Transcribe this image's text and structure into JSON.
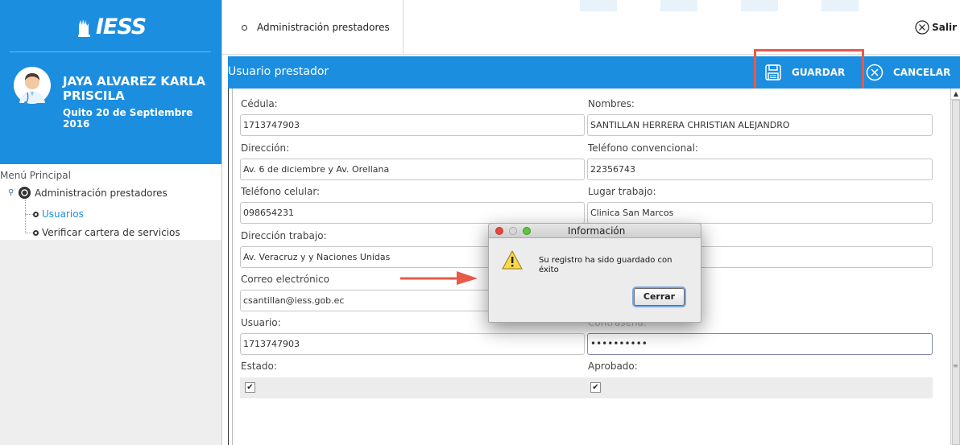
{
  "app": {
    "logo_text": "IESS"
  },
  "user": {
    "name": "JAYA ALVAREZ KARLA PRISCILA",
    "date": "Quito 20 de Septiembre 2016"
  },
  "menu": {
    "title": "Menú Principal",
    "admin": "Administración prestadores",
    "items": [
      "Usuarios",
      "Verificar cartera de servicios"
    ]
  },
  "topbar": {
    "tab": "Administración prestadores",
    "exit": "Salir"
  },
  "header": {
    "title": "Usuario prestador",
    "save": "GUARDAR",
    "cancel": "CANCELAR"
  },
  "form": {
    "cedula_label": "Cédula:",
    "cedula": "1713747903",
    "nombres_label": "Nombres:",
    "nombres": "SANTILLAN HERRERA CHRISTIAN ALEJANDRO",
    "direccion_label": "Dirección:",
    "direccion": "Av. 6 de diciembre y Av. Orellana",
    "telefono_label": "Teléfono convencional:",
    "telefono": "22356743",
    "celular_label": "Teléfono celular:",
    "celular": "098654231",
    "lugar_label": "Lugar trabajo:",
    "lugar": "Clinica San Marcos",
    "dir_trabajo_label": "Dirección trabajo:",
    "dir_trabajo": "Av. Veracruz y y Naciones Unidas",
    "correo_label": "Correo electrónico",
    "correo": "csantillan@iess.gob.ec",
    "usuario_label": "Usuario:",
    "usuario": "1713747903",
    "contrasena_label": "Contraseña:",
    "contrasena": "••••••••••",
    "estado_label": "Estado:",
    "aprobado_label": "Aprobado:",
    "check_mark": "✔"
  },
  "dialog": {
    "title": "Información",
    "message": "Su registro ha sido guardado con éxito",
    "close": "Cerrar"
  },
  "colors": {
    "primary": "#1b8ee0",
    "highlight": "#e85a4a"
  }
}
